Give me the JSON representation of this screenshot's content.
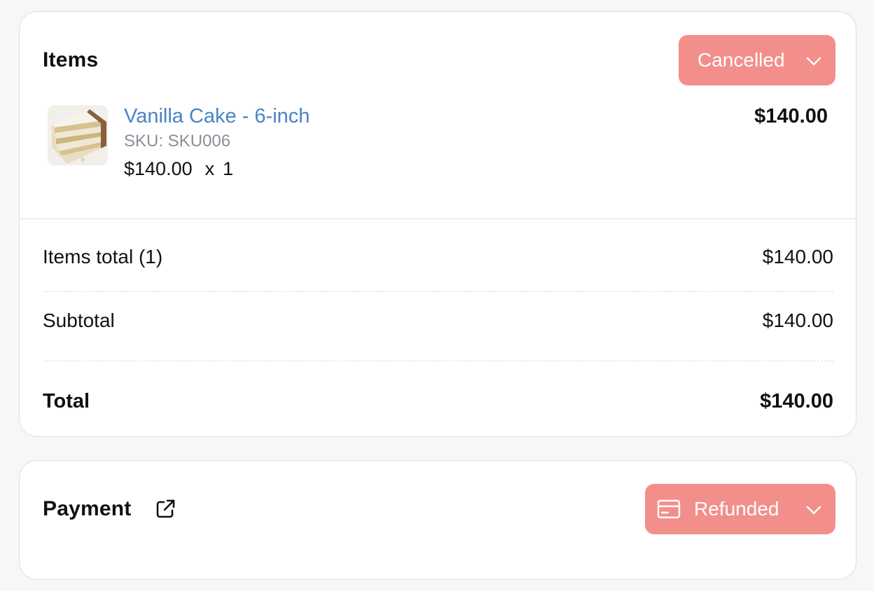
{
  "items_card": {
    "title": "Items",
    "status": {
      "label": "Cancelled",
      "color": "#f28f8b"
    },
    "products": [
      {
        "name": "Vanilla Cake - 6-inch",
        "sku": "SKU: SKU006",
        "unit_price": "$140.00",
        "times": "x",
        "quantity": "1",
        "line_total": "$140.00",
        "thumbnail": "vanilla-cake-image"
      }
    ],
    "summary": {
      "items_total_label": "Items total (1)",
      "items_total_value": "$140.00",
      "subtotal_label": "Subtotal",
      "subtotal_value": "$140.00",
      "total_label": "Total",
      "total_value": "$140.00"
    }
  },
  "payment_card": {
    "title": "Payment",
    "link_icon": "external-link-icon",
    "status": {
      "label": "Refunded",
      "icon": "credit-card-icon",
      "color": "#f28f8b"
    }
  },
  "colors": {
    "page_background": "#f6f7f9",
    "card_border": "#dcdee2",
    "link_blue": "#4a84c4",
    "status_red": "#f28f8b",
    "muted_text": "#8a8f98"
  }
}
